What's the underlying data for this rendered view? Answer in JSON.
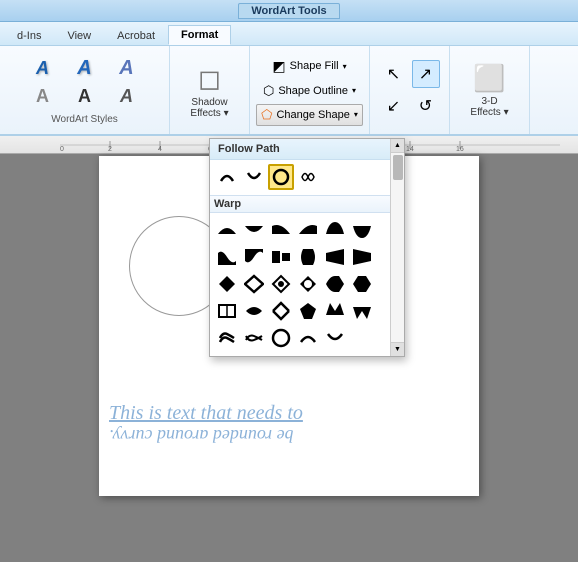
{
  "titleBar": {
    "label": "WordArt Tools"
  },
  "tabs": [
    {
      "id": "add-ins",
      "label": "d-Ins",
      "active": false
    },
    {
      "id": "view",
      "label": "View",
      "active": false
    },
    {
      "id": "acrobat",
      "label": "Acrobat",
      "active": false
    },
    {
      "id": "format",
      "label": "Format",
      "active": true
    }
  ],
  "ribbon": {
    "sections": [
      {
        "id": "wordart-styles",
        "label": "WordArt Styles"
      },
      {
        "id": "shadow-effects",
        "label": "Shadow\nEffects"
      },
      {
        "id": "change-shape",
        "label": "Change Shape"
      },
      {
        "id": "three-d-effects",
        "label": "3-D Effects"
      }
    ],
    "shapeFillLabel": "Shape Fill",
    "shapeOutlineLabel": "Shape Outline",
    "changeShapeLabel": "Change Shape",
    "shadowEffectsLabel": "Shadow\nEffects",
    "threeDEffectsLabel": "3-D\nEffects"
  },
  "dropdown": {
    "followPathLabel": "Follow Path",
    "warpLabel": "Warp",
    "shapes": {
      "followPath": [
        "arc-up",
        "arc-down",
        "circle",
        "arc-both"
      ],
      "warpRow1": [
        "arch-up-fill",
        "arch-up-fill2",
        "arch-up-fill3",
        "arch-up-fill4",
        "arch-up-fill5",
        "arch-up-fill6"
      ],
      "warpRow2": [
        "warp1",
        "warp2",
        "warp3",
        "warp4",
        "warp5",
        "warp6"
      ],
      "warpRow3": [
        "warp7",
        "warp8",
        "warp9",
        "warp10",
        "warp11",
        "warp12"
      ],
      "warpRow4": [
        "warp13",
        "warp14",
        "warp15",
        "warp16",
        "warp17",
        "warp18"
      ],
      "warpRow5": [
        "warp19",
        "warp20",
        "warp21",
        "warp22",
        "warp23",
        "warp24"
      ],
      "warpRow6": [
        "warp25",
        "warp26",
        "warp27",
        "warp28",
        "warp29",
        "warp30"
      ]
    }
  },
  "document": {
    "wordartLine1": "This is text that needs to",
    "wordartLine2": "be rounded around curvy."
  }
}
